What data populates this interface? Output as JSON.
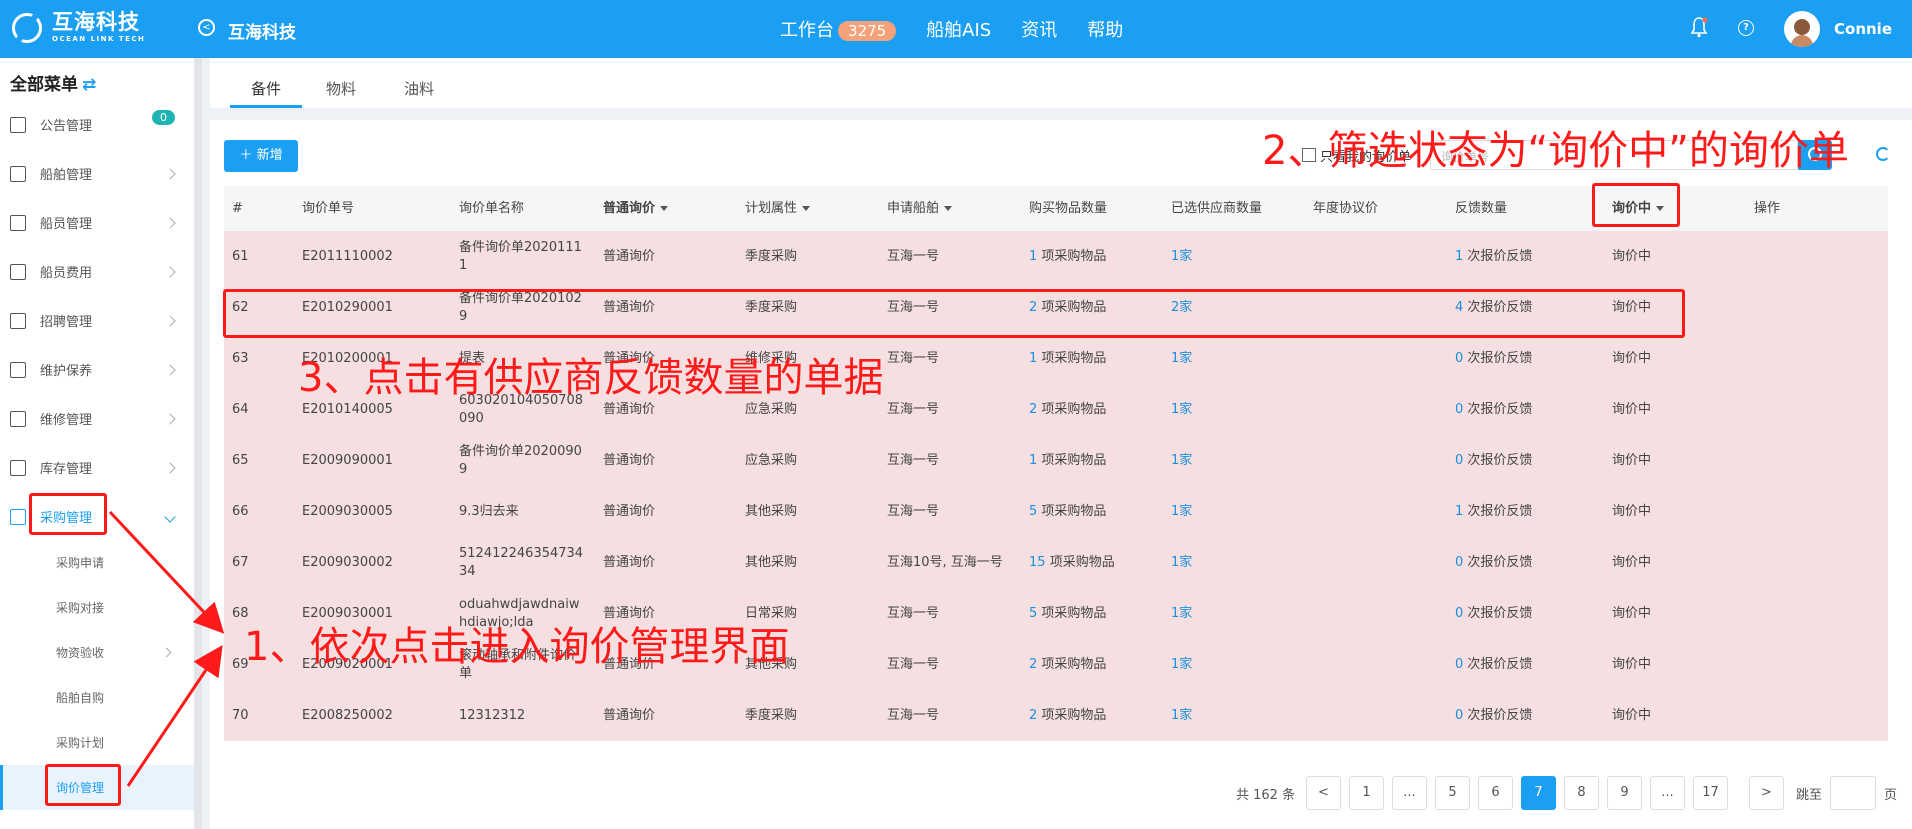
{
  "header": {
    "logo_cn": "互海科技",
    "logo_en": "OCEAN LINK TECH",
    "company": "互海科技",
    "nav": [
      "工作台",
      "船舶AIS",
      "资讯",
      "帮助"
    ],
    "workbench_badge": "3275",
    "username": "Connie"
  },
  "sidebar": {
    "title": "全部菜单",
    "notice_badge": "0",
    "items": [
      "公告管理",
      "船舶管理",
      "船员管理",
      "船员费用",
      "招聘管理",
      "维护保养",
      "维修管理",
      "库存管理",
      "采购管理"
    ],
    "sub_items": [
      "采购申请",
      "采购对接",
      "物资验收",
      "船舶自购",
      "采购计划",
      "询价管理"
    ]
  },
  "tabs": [
    "备件",
    "物料",
    "油料"
  ],
  "toolbar": {
    "add_label": "新增",
    "only_mine_label": "只看我的询价单",
    "search_placeholder": "询价单号"
  },
  "table": {
    "headers": [
      "#",
      "询价单号",
      "询价单名称",
      "普通询价",
      "计划属性",
      "申请船舶",
      "购买物品数量",
      "已选供应商数量",
      "年度协议价",
      "反馈数量",
      "询价中",
      "操作"
    ],
    "rows": [
      {
        "no": "61",
        "code": "E2011110002",
        "name": "备件询价单20201111",
        "type": "普通询价",
        "plan": "季度采购",
        "ship": "互海一号",
        "items_n": "1",
        "items_t": "项采购物品",
        "sup": "1家",
        "annual": "",
        "fb_n": "1",
        "fb_t": "次报价反馈",
        "status": "询价中"
      },
      {
        "no": "62",
        "code": "E2010290001",
        "name": "备件询价单20201029",
        "type": "普通询价",
        "plan": "季度采购",
        "ship": "互海一号",
        "items_n": "2",
        "items_t": "项采购物品",
        "sup": "2家",
        "annual": "",
        "fb_n": "4",
        "fb_t": "次报价反馈",
        "status": "询价中"
      },
      {
        "no": "63",
        "code": "E2010200001",
        "name": "提表",
        "type": "普通询价",
        "plan": "维修采购",
        "ship": "互海一号",
        "items_n": "1",
        "items_t": "项采购物品",
        "sup": "1家",
        "annual": "",
        "fb_n": "0",
        "fb_t": "次报价反馈",
        "status": "询价中"
      },
      {
        "no": "64",
        "code": "E2010140005",
        "name": "603020104050708090",
        "type": "普通询价",
        "plan": "应急采购",
        "ship": "互海一号",
        "items_n": "2",
        "items_t": "项采购物品",
        "sup": "1家",
        "annual": "",
        "fb_n": "0",
        "fb_t": "次报价反馈",
        "status": "询价中"
      },
      {
        "no": "65",
        "code": "E2009090001",
        "name": "备件询价单20200909",
        "type": "普通询价",
        "plan": "应急采购",
        "ship": "互海一号",
        "items_n": "1",
        "items_t": "项采购物品",
        "sup": "1家",
        "annual": "",
        "fb_n": "0",
        "fb_t": "次报价反馈",
        "status": "询价中"
      },
      {
        "no": "66",
        "code": "E2009030005",
        "name": "9.3归去来",
        "type": "普通询价",
        "plan": "其他采购",
        "ship": "互海一号",
        "items_n": "5",
        "items_t": "项采购物品",
        "sup": "1家",
        "annual": "",
        "fb_n": "1",
        "fb_t": "次报价反馈",
        "status": "询价中"
      },
      {
        "no": "67",
        "code": "E2009030002",
        "name": "51241224635473434",
        "type": "普通询价",
        "plan": "其他采购",
        "ship": "互海10号, 互海一号",
        "items_n": "15",
        "items_t": "项采购物品",
        "sup": "1家",
        "annual": "",
        "fb_n": "0",
        "fb_t": "次报价反馈",
        "status": "询价中"
      },
      {
        "no": "68",
        "code": "E2009030001",
        "name": "oduahwdjawdnaiwhdiawjo;lda",
        "type": "普通询价",
        "plan": "日常采购",
        "ship": "互海一号",
        "items_n": "5",
        "items_t": "项采购物品",
        "sup": "1家",
        "annual": "",
        "fb_n": "0",
        "fb_t": "次报价反馈",
        "status": "询价中"
      },
      {
        "no": "69",
        "code": "E2009020001",
        "name": "滚动轴承和附件询价单",
        "type": "普通询价",
        "plan": "其他采购",
        "ship": "互海一号",
        "items_n": "2",
        "items_t": "项采购物品",
        "sup": "1家",
        "annual": "",
        "fb_n": "0",
        "fb_t": "次报价反馈",
        "status": "询价中"
      },
      {
        "no": "70",
        "code": "E2008250002",
        "name": "12312312",
        "type": "普通询价",
        "plan": "季度采购",
        "ship": "互海一号",
        "items_n": "2",
        "items_t": "项采购物品",
        "sup": "1家",
        "annual": "",
        "fb_n": "0",
        "fb_t": "次报价反馈",
        "status": "询价中"
      }
    ]
  },
  "pagination": {
    "total": "共 162 条",
    "prev": "<",
    "pages": [
      "1",
      "...",
      "5",
      "6",
      "7",
      "8",
      "9",
      "...",
      "17"
    ],
    "active": "7",
    "next": ">",
    "jump_label": "跳至",
    "page_unit": "页"
  },
  "annotations": {
    "step1": "1、依次点击进入询价管理界面",
    "step2": "2、筛选状态为“询价中”的询价单",
    "step3": "3、点击有供应商反馈数量的单据"
  },
  "colors": {
    "primary": "#1a9ff2",
    "annotation": "#ff1a1a",
    "row_bg": "#f5dfe1"
  }
}
